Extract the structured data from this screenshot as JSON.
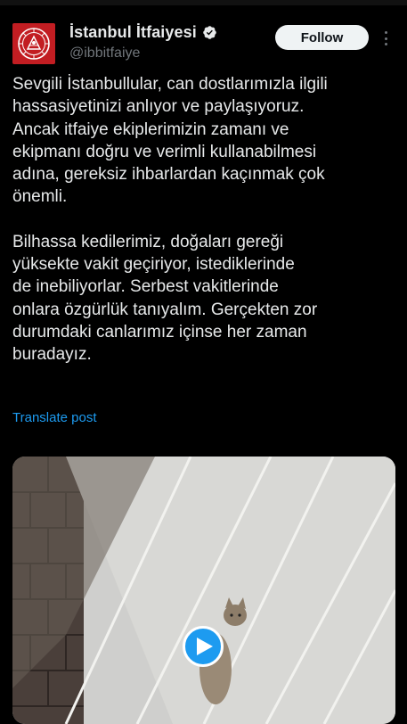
{
  "account": {
    "display_name": "İstanbul İtfaiyesi",
    "handle": "@ibbitfaiye",
    "verified": true,
    "avatar_icon": "fire-department-emblem-icon",
    "verified_icon": "verified-badge-icon"
  },
  "actions": {
    "follow_label": "Follow",
    "more_icon": "more-options-icon"
  },
  "post": {
    "paragraph_1": "Sevgili İstanbullular, can dostlarımızla ilgili\nhassasiyetinizi anlıyor ve paylaşıyoruz.\nAncak itfaiye ekiplerimizin zamanı ve\nekipmanı doğru ve verimli kullanabilmesi\nadına, gereksiz ihbarlardan kaçınmak çok\nönemli.",
    "paragraph_2": "Bilhassa kedilerimiz, doğaları gereği\nyüksekte vakit geçiriyor, istediklerinde\nde inebiliyorlar. Serbest vakitlerinde\nonlara özgürlük tanıyalım. Gerçekten zor\ndurumdaki canlarımız içinse her zaman\nburadayız.",
    "translate_label": "Translate post"
  },
  "media": {
    "type": "video",
    "play_icon": "play-icon"
  },
  "colors": {
    "background": "#000000",
    "text": "#e7e9ea",
    "muted": "#71767b",
    "accent": "#1d9bf0",
    "avatar_red": "#c21d22"
  }
}
